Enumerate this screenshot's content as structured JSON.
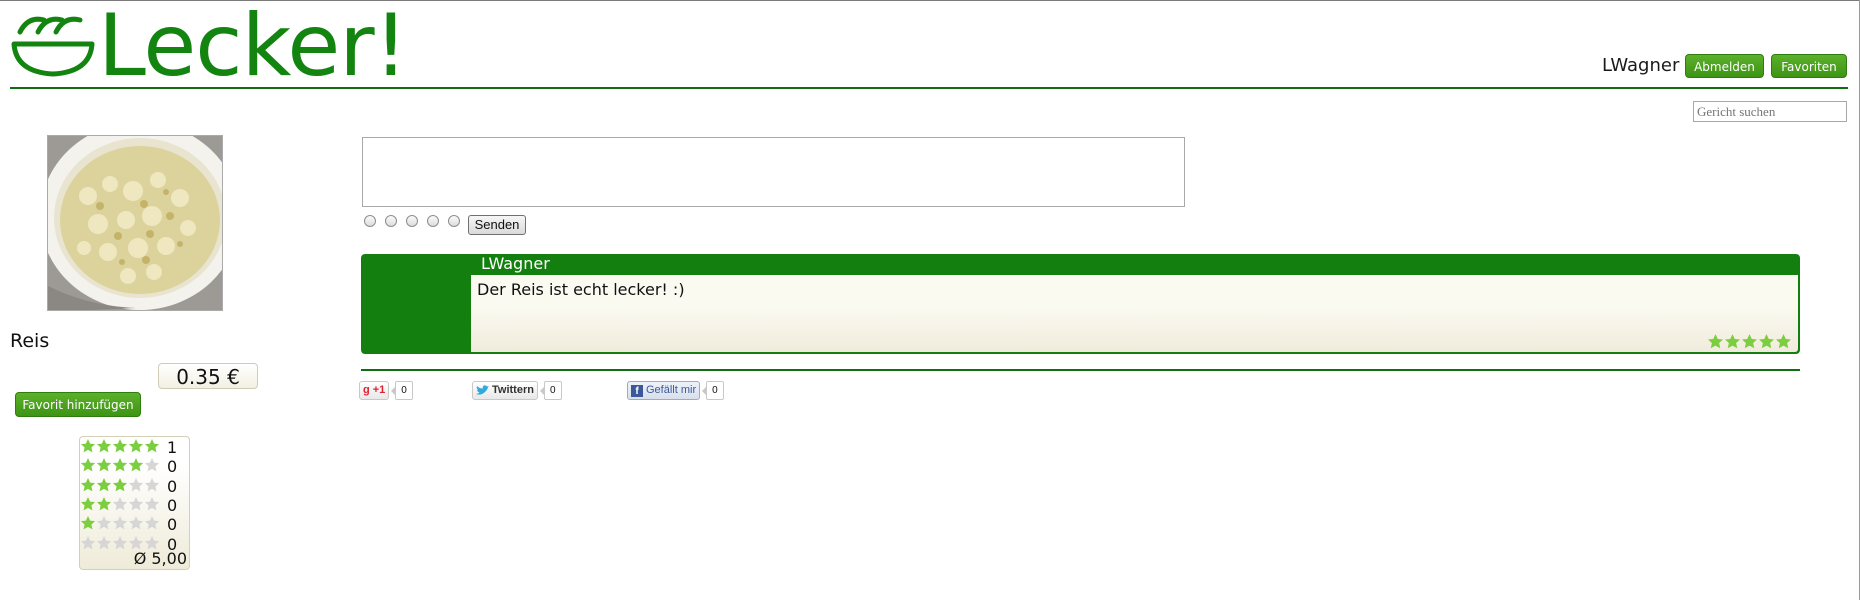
{
  "header": {
    "logo_text": "Lecker!",
    "username": "LWagner",
    "logout_label": "Abmelden",
    "favorites_label": "Favoriten",
    "search_placeholder": "Gericht suchen"
  },
  "dish": {
    "name": "Reis",
    "price": "0.35 €",
    "add_favorite_label": "Favorit hinzufügen",
    "ratings": [
      {
        "stars": 5,
        "count": "1"
      },
      {
        "stars": 4,
        "count": "0"
      },
      {
        "stars": 3,
        "count": "0"
      },
      {
        "stars": 2,
        "count": "0"
      },
      {
        "stars": 1,
        "count": "0"
      },
      {
        "stars": 0,
        "count": "0"
      }
    ],
    "average": "Ø 5,00"
  },
  "comment_form": {
    "rating_options": 5,
    "send_label": "Senden"
  },
  "comments": [
    {
      "author": "LWagner",
      "text": "Der Reis ist echt lecker! :)",
      "stars": 5
    }
  ],
  "social": {
    "gplus_label": "+1",
    "gplus_count": "0",
    "twitter_label": "Twittern",
    "twitter_count": "0",
    "facebook_label": "Gefällt mir",
    "facebook_count": "0"
  },
  "colors": {
    "brand_green": "#138410",
    "button_green": "#4aa31c",
    "star_filled": "#7ccd3f",
    "star_empty": "#d6d6d6"
  }
}
